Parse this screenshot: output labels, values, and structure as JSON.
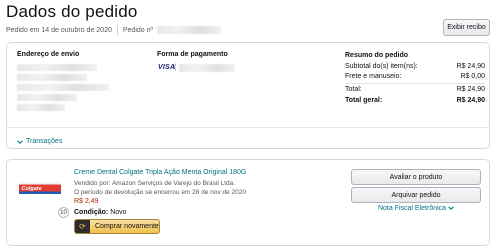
{
  "page": {
    "title": "Dados do pedido"
  },
  "meta": {
    "order_date": "Pedido em 14 de outubro de 2020",
    "order_number_label": "Pedido nº"
  },
  "actions": {
    "receipt_label": "Exibir recibo"
  },
  "summary_panel": {
    "address_heading": "Endereço de envio",
    "payment_heading": "Forma de pagamento",
    "payment_card_brand": "VISA",
    "payment_card_prefix": "(",
    "order_summary": {
      "heading": "Resumo do pedido",
      "rows": [
        {
          "label": "Subtotal do(s) item(ns):",
          "value": "R$ 24,90"
        },
        {
          "label": "Frete e manuseio:",
          "value": "R$ 0,00"
        },
        {
          "label": "Total:",
          "value": "R$ 24,90"
        },
        {
          "label": "Total geral:",
          "value": "R$ 24,90"
        }
      ]
    },
    "transactions_label": "Transações"
  },
  "item": {
    "title": "Creme Dental Colgate Tripla Ação Menta Original 180G",
    "seller": "Vendido por: Amazon Serviços de Varejo do Brasil Ltda.",
    "return_notice": "O período de devolução se encerrou em 28 de nov de 2020",
    "price": "R$ 2,49",
    "condition_label": "Condição:",
    "condition_value": "Novo",
    "quantity": "10",
    "buy_again_label": "Comprar novamente",
    "review_label": "Avaliar o produto",
    "archive_label": "Arquivar pedido",
    "invoice_label": "Nota Fiscal Eletrônica",
    "brand_logo": "Colgate"
  },
  "icons": {
    "transactions": "chevron-down-icon",
    "invoice": "chevron-down-icon",
    "buy_again": "cart-refresh-icon"
  },
  "colors": {
    "link": "#007185",
    "price": "#b12704",
    "buy_button": "#f0c14b"
  }
}
